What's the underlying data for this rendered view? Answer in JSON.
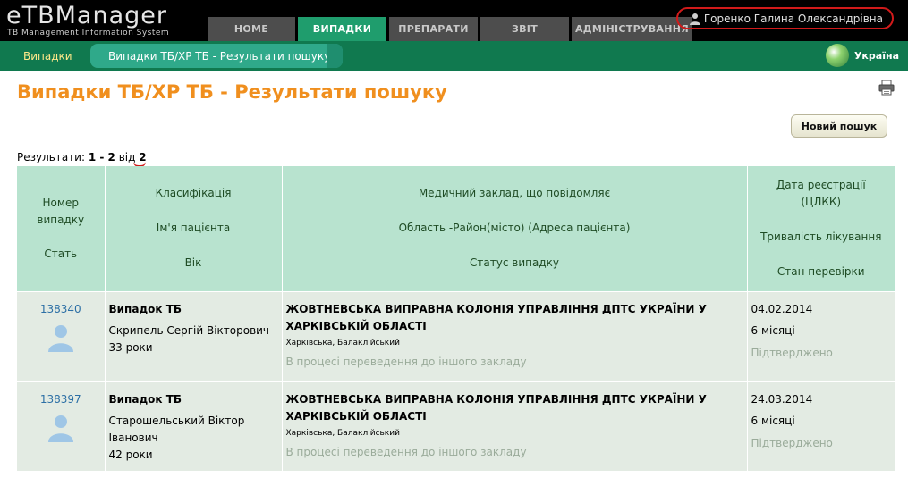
{
  "app": {
    "logo": "eTBManager",
    "logo_sub": "TB Management Information System"
  },
  "nav": {
    "tabs": [
      {
        "label": "HOME"
      },
      {
        "label": "ВИПАДКИ"
      },
      {
        "label": "ПРЕПАРАТИ"
      },
      {
        "label": "ЗВІТ"
      },
      {
        "label": "АДМІНІСТРУВАННЯ"
      }
    ]
  },
  "user": {
    "name": "Горенко Галина Олександрівна"
  },
  "breadcrumb": {
    "root": "Випадки",
    "current": "Випадки ТБ/ХР ТБ - Результати пошуку"
  },
  "region": {
    "label": "Україна"
  },
  "page": {
    "title": "Випадки ТБ/ХР ТБ - Результати пошуку",
    "new_search_label": "Новий пошук",
    "results_prefix": "Результати:",
    "results_range": "1 - 2",
    "results_of": "від",
    "results_total": "2"
  },
  "table": {
    "headers": {
      "col1": [
        "Номер випадку",
        "Стать"
      ],
      "col2": [
        "Класифікація",
        "Ім'я пацієнта",
        "Вік"
      ],
      "col3": [
        "Медичний заклад, що повідомляє",
        "Область -Район(місто) (Адреса пацієнта)",
        "Статус випадку"
      ],
      "col4": [
        "Дата реєстрації (ЦЛКК)",
        "Тривалість лікування",
        "Стан перевірки"
      ]
    },
    "rows": [
      {
        "case_number": "138340",
        "classification": "Випадок ТБ",
        "patient_name": "Скрипель Сергій Вікторович",
        "age": "33 роки",
        "facility": "ЖОВТНЕВСЬКА ВИПРАВНА КОЛОНІЯ УПРАВЛІННЯ ДПТС УКРАЇНИ У ХАРКІВСЬКІЙ ОБЛАСТІ",
        "address": "Харківська, Балаклійський",
        "status": "В процесі переведення до іншого закладу",
        "reg_date": "04.02.2014",
        "duration": "6 місяці",
        "validation": "Підтверджено"
      },
      {
        "case_number": "138397",
        "classification": "Випадок ТБ",
        "patient_name": "Старошельський Віктор Іванович",
        "age": "42 роки",
        "facility": "ЖОВТНЕВСЬКА ВИПРАВНА КОЛОНІЯ УПРАВЛІННЯ ДПТС УКРАЇНИ У ХАРКІВСЬКІЙ ОБЛАСТІ",
        "address": "Харківська, Балаклійський",
        "status": "В процесі переведення до іншого закладу",
        "reg_date": "24.03.2014",
        "duration": "6 місяці",
        "validation": "Підтверджено"
      }
    ]
  },
  "icons": {
    "user": "user-icon",
    "globe": "globe-icon",
    "print": "print-icon",
    "patient": "male-patient-icon"
  },
  "colors": {
    "title_orange": "#f08f1e",
    "active_tab": "#1f9d6d",
    "subbar_green": "#10794f",
    "header_cell": "#b8e3cf",
    "row_bg": "#e3ebe3",
    "link_blue": "#2c6fa5",
    "annotation_red": "#d11a1a"
  }
}
